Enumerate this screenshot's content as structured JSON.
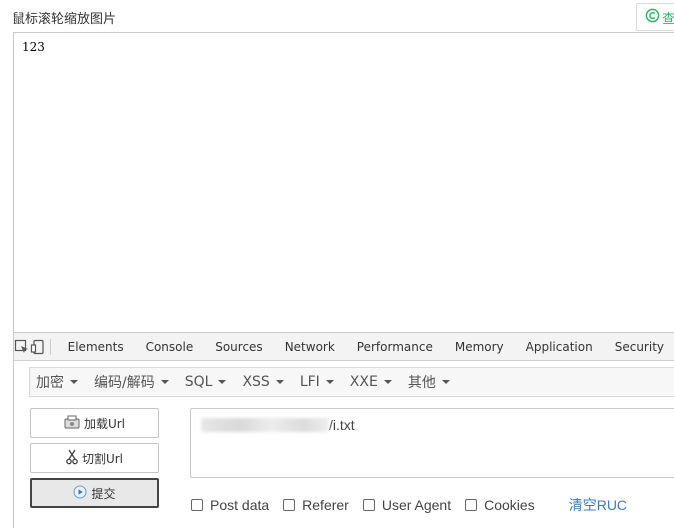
{
  "caption": "鼠标滚轮缩放图片",
  "top_button": {
    "label": "查",
    "icon": "c-circle-icon",
    "color": "#2bb56b"
  },
  "page": {
    "content": "123"
  },
  "devtools": {
    "tabs": [
      "Elements",
      "Console",
      "Sources",
      "Network",
      "Performance",
      "Memory",
      "Application",
      "Security"
    ]
  },
  "hackbar": {
    "menus": [
      "加密",
      "编码/解码",
      "SQL",
      "XSS",
      "LFI",
      "XXE",
      "其他"
    ],
    "buttons": {
      "load_url": "加载Url",
      "split_url": "切割Url",
      "submit": "提交"
    },
    "url_suffix": "/i.txt",
    "options": [
      "Post data",
      "Referer",
      "User Agent",
      "Cookies"
    ],
    "clear_link": "清空RUC"
  }
}
